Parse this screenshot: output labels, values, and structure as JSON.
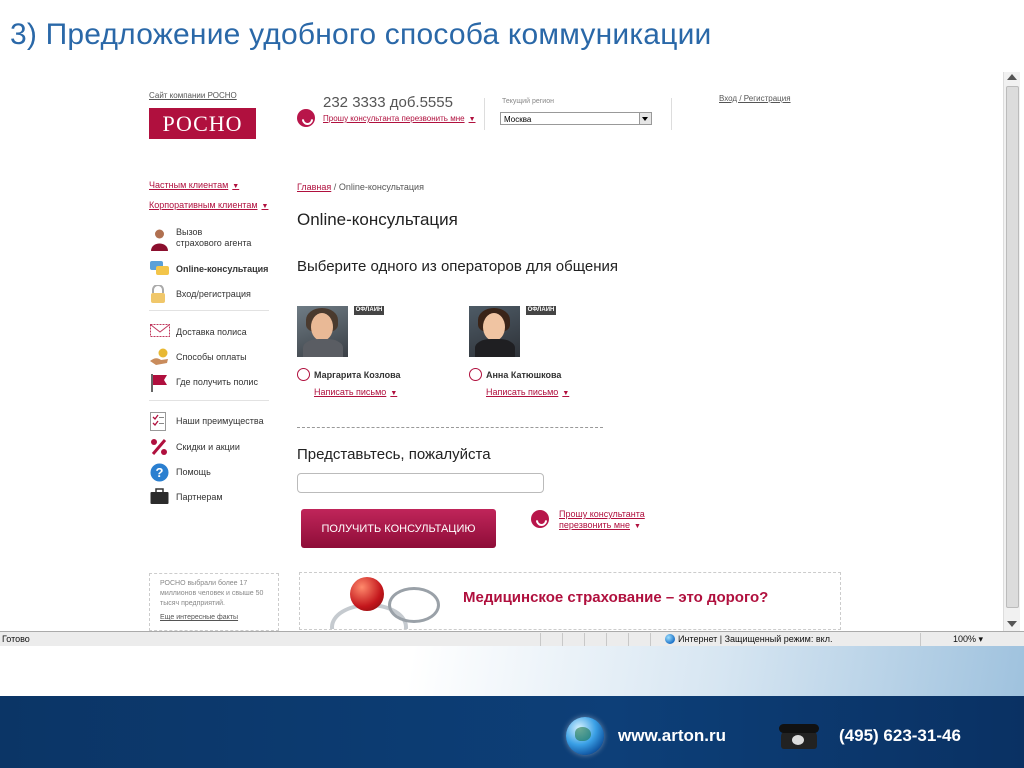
{
  "slide": {
    "title": "3) Предложение удобного способа коммуникации",
    "footer_site": "www.arton.ru",
    "footer_phone": "(495) 623-31-46"
  },
  "site": {
    "company_link": "Сайт компании РОСНО",
    "logo": "РОСНО",
    "phone": "232 3333 доб.5555",
    "callback_link": "Прошу консультанта перезвонить мне",
    "region_label": "Текущий регион",
    "region_value": "Москва",
    "login_link": "Вход / Регистрация"
  },
  "sidebar": {
    "private_clients": "Частным клиентам",
    "corporate_clients": "Корпоративным клиентам",
    "items": [
      {
        "icon": "agent-icon",
        "label_line1": "Вызов",
        "label_line2": "страхового агента"
      },
      {
        "icon": "chat-icon",
        "label_line1": "Online-консультация",
        "label_line2": ""
      },
      {
        "icon": "lock-icon",
        "label_line1": "Вход/регистрация",
        "label_line2": ""
      },
      {
        "icon": "envelope-icon",
        "label_line1": "Доставка полиса",
        "label_line2": ""
      },
      {
        "icon": "hand-coin-icon",
        "label_line1": "Способы оплаты",
        "label_line2": ""
      },
      {
        "icon": "flag-icon",
        "label_line1": "Где получить полис",
        "label_line2": ""
      },
      {
        "icon": "checklist-icon",
        "label_line1": "Наши преимущества",
        "label_line2": ""
      },
      {
        "icon": "percent-icon",
        "label_line1": "Скидки и акции",
        "label_line2": ""
      },
      {
        "icon": "help-icon",
        "label_line1": "Помощь",
        "label_line2": ""
      },
      {
        "icon": "briefcase-icon",
        "label_line1": "Партнерам",
        "label_line2": ""
      }
    ],
    "promo_text": "РОСНО выбрали более 17 миллионов человек и свыше 50 тысяч предприятий.",
    "promo_link": "Еще интересные факты"
  },
  "main": {
    "breadcrumb_home": "Главная",
    "breadcrumb_sep": "/",
    "breadcrumb_current": "Online-консультация",
    "heading": "Online-консультация",
    "choose_operator": "Выберите одного из операторов для общения",
    "operators": [
      {
        "name": "Маргарита Козлова",
        "status": "ОФЛАЙН",
        "write_link": "Написать письмо"
      },
      {
        "name": "Анна Катюшкова",
        "status": "ОФЛАЙН",
        "write_link": "Написать письмо"
      }
    ],
    "introduce_label": "Представьтесь, пожалуйста",
    "name_value": "",
    "cta_button": "ПОЛУЧИТЬ КОНСУЛЬТАЦИЮ",
    "callback_line1": "Прошу консультанта",
    "callback_line2": "перезвонить мне",
    "banner_text": "Медицинское страхование – это дорого?"
  },
  "browser": {
    "status_ready": "Готово",
    "status_zone": "Интернет | Защищенный режим: вкл.",
    "zoom": "100%"
  },
  "colors": {
    "brand": "#b0103e",
    "title_blue": "#2a68a8",
    "footer_navy": "#0b3566"
  }
}
